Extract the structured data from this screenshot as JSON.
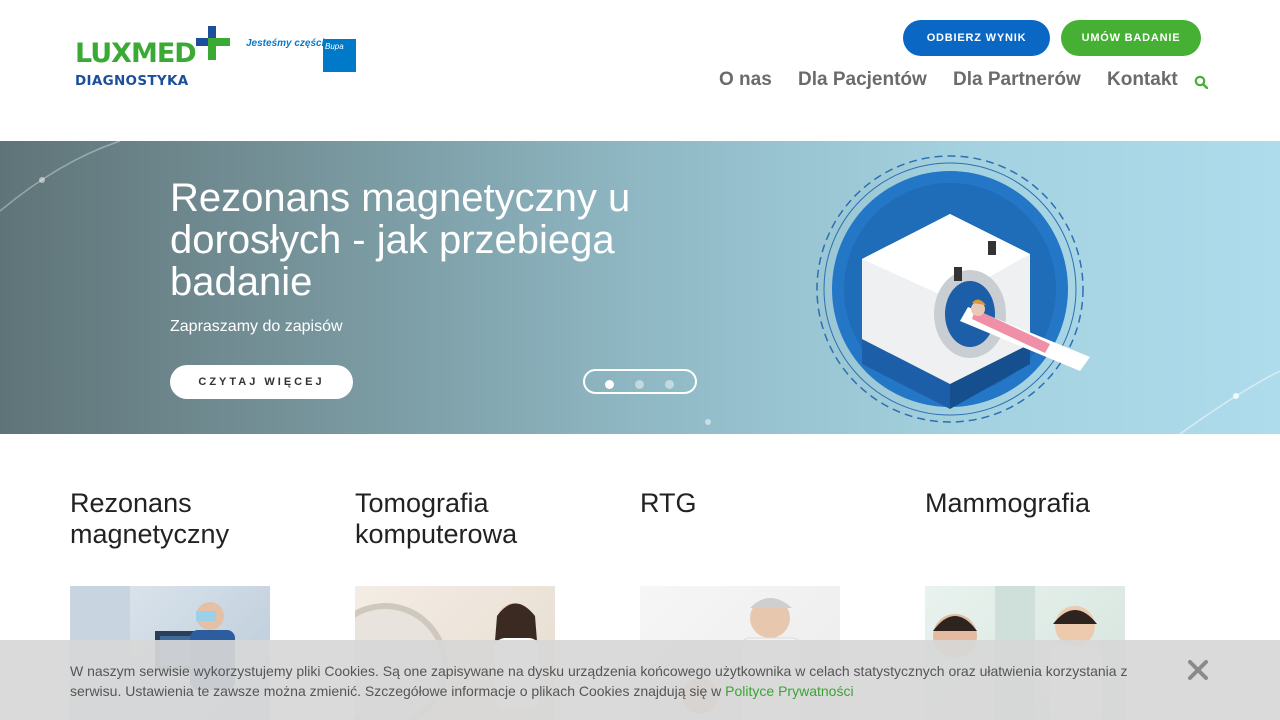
{
  "header": {
    "logo": {
      "brand": "LUXMED",
      "sub": "DIAGNOSTYKA",
      "tagline": "Jesteśmy częścią",
      "partner": "Bupa"
    },
    "buttons": {
      "results": "ODBIERZ WYNIK",
      "book": "UMÓW BADANIE"
    },
    "nav": [
      "O nas",
      "Dla Pacjentów",
      "Dla Partnerów",
      "Kontakt"
    ],
    "search_icon": "search-icon"
  },
  "hero": {
    "title": "Rezonans magnetyczny u dorosłych - jak przebiega badanie",
    "subtitle": "Zapraszamy do zapisów",
    "button": "CZYTAJ WIĘCEJ",
    "slides": 3,
    "active_slide": 1
  },
  "cards": [
    {
      "title": "Rezonans magnetyczny"
    },
    {
      "title": "Tomografia komputerowa"
    },
    {
      "title": "RTG"
    },
    {
      "title": "Mammografia"
    }
  ],
  "cookie": {
    "text": "W naszym serwisie wykorzystujemy pliki Cookies. Są one zapisywane na dysku urządzenia końcowego użytkownika w celach statystycznych oraz ułatwienia korzystania z serwisu. Ustawienia te zawsze można zmienić. Szczegółowe informacje o plikach Cookies znajdują się w ",
    "link": "Polityce Prywatności"
  },
  "colors": {
    "brand_green": "#3aaa35",
    "brand_blue": "#1b4f9c",
    "button_blue": "#0a67c3",
    "button_green": "#45b034"
  }
}
